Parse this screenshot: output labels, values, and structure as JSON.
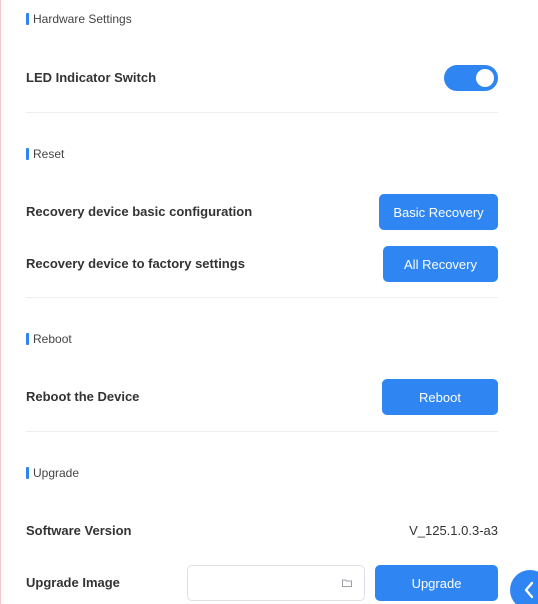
{
  "hardware": {
    "title": "Hardware Settings",
    "led_label": "LED Indicator Switch",
    "led_enabled": true
  },
  "reset": {
    "title": "Reset",
    "basic_label": "Recovery device basic configuration",
    "basic_button": "Basic Recovery",
    "factory_label": "Recovery device to factory settings",
    "factory_button": "All Recovery"
  },
  "reboot": {
    "title": "Reboot",
    "label": "Reboot the Device",
    "button": "Reboot"
  },
  "upgrade": {
    "title": "Upgrade",
    "version_label": "Software Version",
    "version_value": "V_125.1.0.3-a3",
    "image_label": "Upgrade Image",
    "image_value": "",
    "button": "Upgrade"
  },
  "colors": {
    "accent": "#2f86f2"
  },
  "icons": {
    "file_picker": "folder-icon",
    "fab": "chevron-left-icon"
  }
}
